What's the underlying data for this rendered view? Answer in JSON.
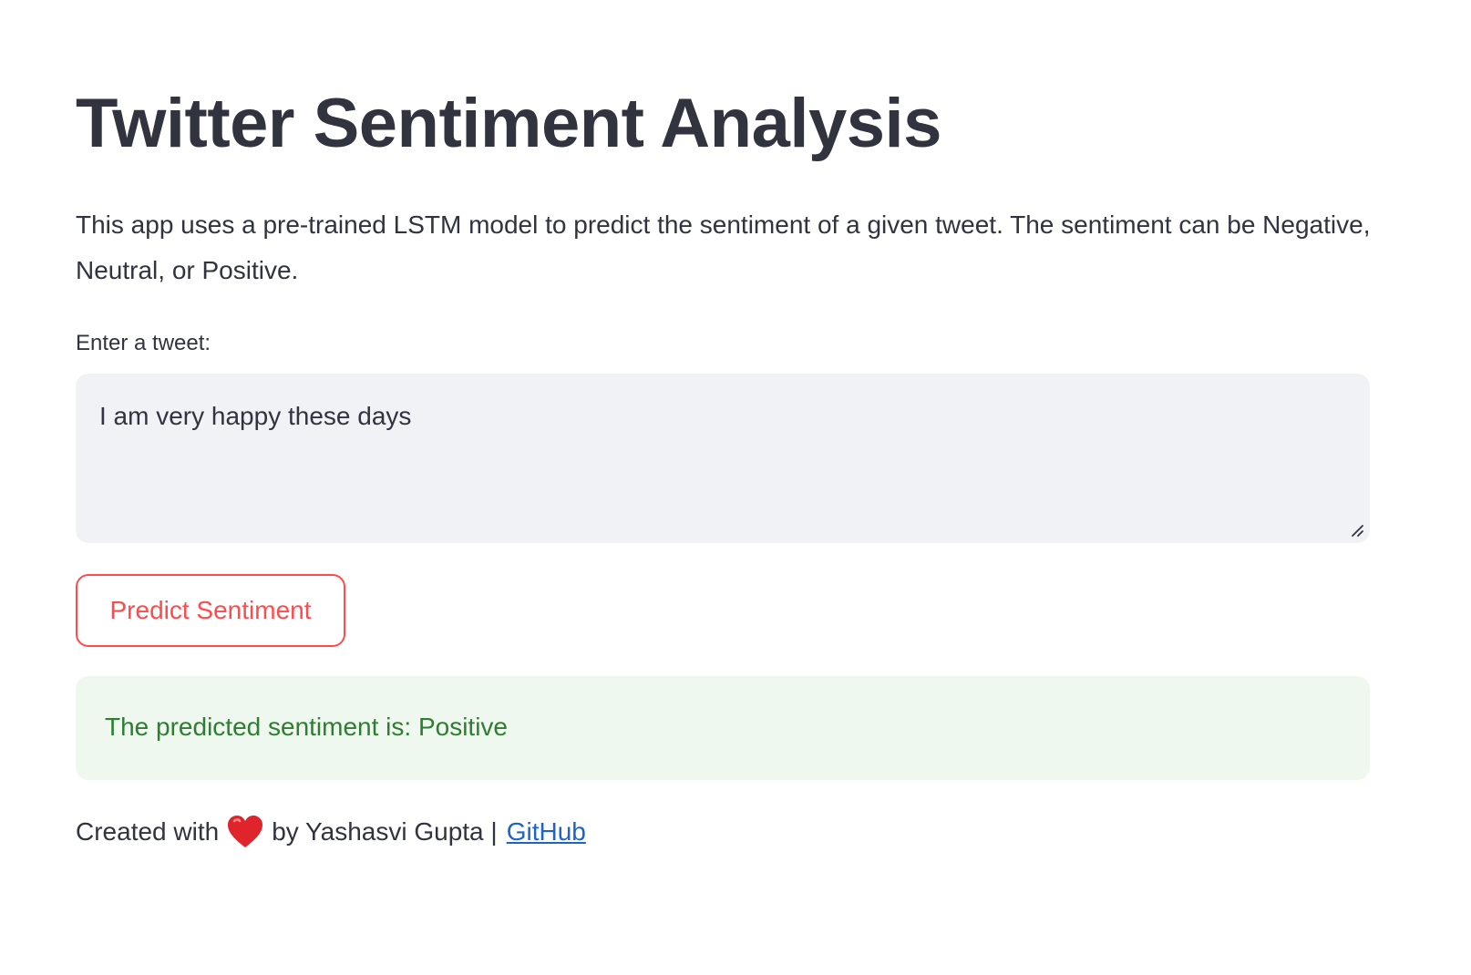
{
  "header": {
    "title": "Twitter Sentiment Analysis"
  },
  "description": "This app uses a pre-trained LSTM model to predict the sentiment of a given tweet. The sentiment can be Negative, Neutral, or Positive.",
  "tweet_input": {
    "label": "Enter a tweet:",
    "value": "I am very happy these days"
  },
  "predict_button": {
    "label": "Predict Sentiment"
  },
  "result": {
    "text": "The predicted sentiment is: Positive"
  },
  "footer": {
    "prefix": "Created with",
    "icon": "heart-icon",
    "suffix": "by Yashasvi Gupta |",
    "link_label": "GitHub"
  },
  "colors": {
    "primary": "#ff4b4b",
    "text": "#31333f",
    "input_bg": "#f0f2f6",
    "success_bg": "#eef8ee",
    "success_text": "#2e7d32",
    "link": "#1c65c7"
  }
}
